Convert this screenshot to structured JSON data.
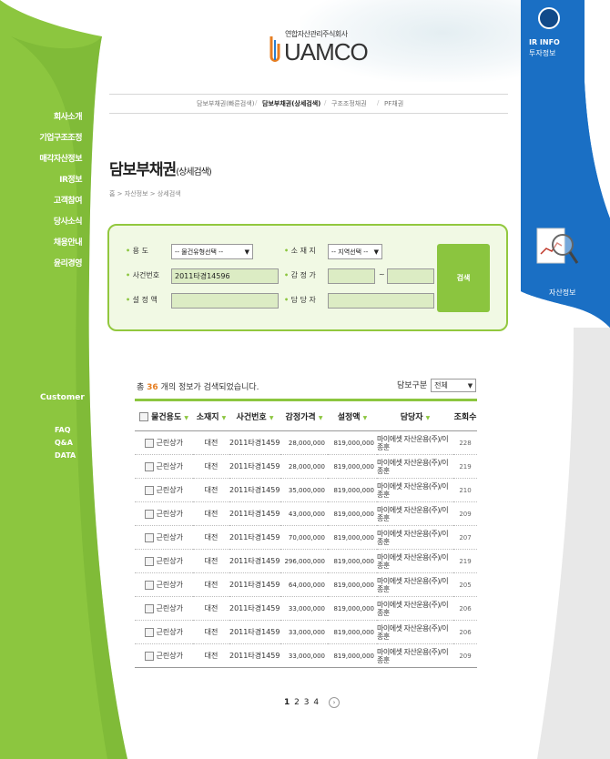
{
  "logo": {
    "subtitle": "연합자산관리주식회사",
    "name": "UAMCO"
  },
  "ir_tab": {
    "title": "IR INFO",
    "subtitle": "투자정보"
  },
  "side_promo": {
    "label": "자산정보"
  },
  "sidebar": {
    "items": [
      "회사소개",
      "기업구조조정",
      "매각자산정보",
      "IR정보",
      "고객참여",
      "당사소식",
      "채용안내",
      "윤리경영"
    ],
    "customer_title": "Customer",
    "customer_links": [
      "FAQ",
      "Q&A",
      "DATA"
    ]
  },
  "tabs": [
    "담보부채권(빠른검색)",
    "담보부채권(상세검색)",
    "구조조정채권",
    "PF채권"
  ],
  "active_tab": 1,
  "page": {
    "title": "담보부채권",
    "title_sub": "(상세검색)",
    "breadcrumb": "홈 > 자산정보 > 상세검색"
  },
  "search": {
    "usage_label": "용   도",
    "usage_value": "-- 물건유형선택 --",
    "location_label": "소 재 지",
    "location_value": "-- 지역선택 --",
    "case_label": "사건번호",
    "case_value": "2011타경14596",
    "appraisal_label": "감 정 가",
    "appraisal_sep": "~",
    "setting_label": "설 정 액",
    "manager_label": "담 당 자",
    "button": "검색"
  },
  "results": {
    "prefix": "총",
    "count": "36",
    "suffix": "개의 정보가 검색되었습니다.",
    "filter_label": "담보구분",
    "filter_value": "전체"
  },
  "table": {
    "headers": [
      "물건용도",
      "소재지",
      "사건번호",
      "감정가격",
      "설정액",
      "담당자",
      "조회수"
    ],
    "rows": [
      [
        "근린상가",
        "대전",
        "2011타경14596",
        "28,000,000",
        "819,000,000",
        "마이에셋 자산운용(주)/이종훈",
        "228"
      ],
      [
        "근린상가",
        "대전",
        "2011타경14596",
        "28,000,000",
        "819,000,000",
        "마이에셋 자산운용(주)/이종훈",
        "219"
      ],
      [
        "근린상가",
        "대전",
        "2011타경14596",
        "35,000,000",
        "819,000,000",
        "마이에셋 자산운용(주)/이종훈",
        "210"
      ],
      [
        "근린상가",
        "대전",
        "2011타경14596",
        "43,000,000",
        "819,000,000",
        "마이에셋 자산운용(주)/이종훈",
        "209"
      ],
      [
        "근린상가",
        "대전",
        "2011타경14596",
        "70,000,000",
        "819,000,000",
        "마이에셋 자산운용(주)/이종훈",
        "207"
      ],
      [
        "근린상가",
        "대전",
        "2011타경14596",
        "296,000,000",
        "819,000,000",
        "마이에셋 자산운용(주)/이종훈",
        "219"
      ],
      [
        "근린상가",
        "대전",
        "2011타경14596",
        "64,000,000",
        "819,000,000",
        "마이에셋 자산운용(주)/이종훈",
        "205"
      ],
      [
        "근린상가",
        "대전",
        "2011타경14596",
        "33,000,000",
        "819,000,000",
        "마이에셋 자산운용(주)/이종훈",
        "206"
      ],
      [
        "근린상가",
        "대전",
        "2011타경14596",
        "33,000,000",
        "819,000,000",
        "마이에셋 자산운용(주)/이종훈",
        "206"
      ],
      [
        "근린상가",
        "대전",
        "2011타경14596",
        "33,000,000",
        "819,000,000",
        "마이에셋 자산운용(주)/이종훈",
        "209"
      ]
    ]
  },
  "pagination": {
    "pages": [
      "1",
      "2",
      "3",
      "4"
    ],
    "current": "1",
    "next": "›"
  },
  "colors": {
    "green": "#8cc63f",
    "blue": "#1a6fc4",
    "accent": "#e67e22"
  }
}
